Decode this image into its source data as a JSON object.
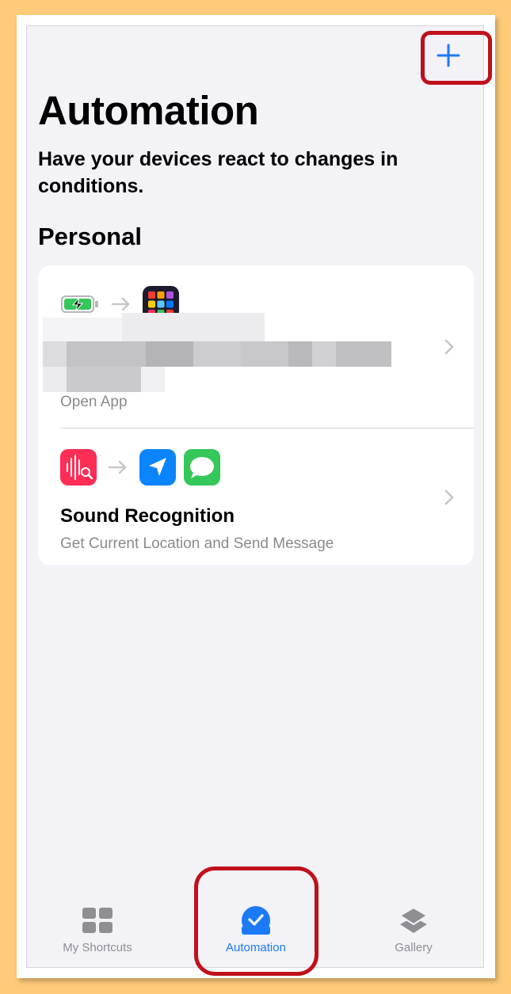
{
  "header": {
    "add_icon": "plus-icon",
    "title": "Automation",
    "subtitle": "Have your devices react to changes in conditions."
  },
  "section": {
    "title": "Personal"
  },
  "automations": [
    {
      "trigger_icon": "battery-charging-icon",
      "action_icons": [
        "app-grid-icon"
      ],
      "title": "",
      "subtitle": "Open App",
      "title_obscured": true
    },
    {
      "trigger_icon": "sound-recognition-icon",
      "action_icons": [
        "location-arrow-icon",
        "messages-icon"
      ],
      "title": "Sound Recognition",
      "subtitle": "Get Current Location and Send Message"
    }
  ],
  "tabbar": {
    "tabs": [
      {
        "label": "My Shortcuts",
        "icon": "grid-icon",
        "active": false
      },
      {
        "label": "Automation",
        "icon": "automation-check-icon",
        "active": true
      },
      {
        "label": "Gallery",
        "icon": "layers-icon",
        "active": false
      }
    ]
  },
  "colors": {
    "accent": "#1b7bf6",
    "highlight": "#C0101A",
    "background": "#F2F2F7",
    "outer": "#FFCB7A"
  }
}
